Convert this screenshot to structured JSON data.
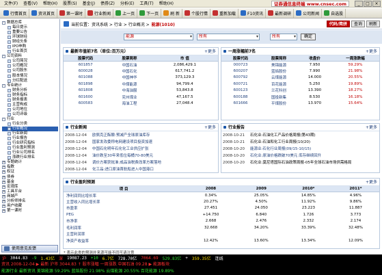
{
  "menu": [
    "文件(F)",
    "查看(V)",
    "帮助(H)",
    "股票(S)",
    "基金(J)",
    "债券(Z)",
    "分析(E)",
    "工具(T)",
    "帮助(H)"
  ],
  "brand": "证券通信息终端 www.cnsec.com",
  "window_buttons": [
    "_",
    "□",
    "×"
  ],
  "toolbar": [
    "行情首页",
    "资讯首页",
    "第一课时",
    "行业新闻",
    "上一页",
    "下一页",
    "刷 新",
    "个股行情",
    "重新加载",
    "F10资讯",
    "最新调研",
    "公司新闻",
    "自选股"
  ],
  "tree": [
    {
      "label": "数据总库",
      "level": 0,
      "box": "-"
    },
    {
      "label": "每日提示",
      "level": 1
    },
    {
      "label": "重要公告",
      "level": 1
    },
    {
      "label": "环球财经",
      "level": 1
    },
    {
      "label": "财经头条",
      "level": 1
    },
    {
      "label": "IPO申购",
      "level": 1
    },
    {
      "label": "行业首页",
      "level": 1
    },
    {
      "label": "公司资料",
      "level": 0,
      "box": "-"
    },
    {
      "label": "公司简况",
      "level": 1
    },
    {
      "label": "公司概况",
      "level": 1
    },
    {
      "label": "公司股东",
      "level": 1
    },
    {
      "label": "股本情况",
      "level": 1
    },
    {
      "label": "分红配送",
      "level": 1
    },
    {
      "label": "专业统计",
      "level": 0,
      "box": "-"
    },
    {
      "label": "财务分析",
      "level": 1
    },
    {
      "label": "财务指标",
      "level": 1
    },
    {
      "label": "财务报表",
      "level": 1
    },
    {
      "label": "主营构成",
      "level": 1
    },
    {
      "label": "公司地位",
      "level": 1
    },
    {
      "label": "公司评级",
      "level": 1
    },
    {
      "label": "行业",
      "level": 0,
      "box": "-"
    },
    {
      "label": "行业分类",
      "level": 1
    },
    {
      "label": "行业概况",
      "level": 1,
      "selected": true
    },
    {
      "label": "行业新闻",
      "level": 1
    },
    {
      "label": "行业报告",
      "level": 1
    },
    {
      "label": "行业研究指标",
      "level": 1
    },
    {
      "label": "行业盈利预测",
      "level": 1
    },
    {
      "label": "行业公司排名",
      "level": 1
    },
    {
      "label": "涨跌行业排名",
      "level": 1
    },
    {
      "label": "专题统计",
      "level": 0,
      "box": "+"
    },
    {
      "label": "指数",
      "level": 0,
      "box": "+"
    },
    {
      "label": "权证",
      "level": 0,
      "box": "+"
    },
    {
      "label": "债券",
      "level": 0,
      "box": "+"
    },
    {
      "label": "基金",
      "level": 0,
      "box": "+"
    },
    {
      "label": "宏观库",
      "level": 0,
      "box": "+"
    },
    {
      "label": "工具平台",
      "level": 0,
      "box": "+"
    },
    {
      "label": "商城产",
      "level": 0,
      "box": "+"
    },
    {
      "label": "分析师排名",
      "level": 0,
      "box": "+"
    },
    {
      "label": "用户收藏",
      "level": 0,
      "box": "+"
    },
    {
      "label": "第一课时",
      "level": 0,
      "box": "+"
    }
  ],
  "feedback_label": "使用意见反馈",
  "breadcrumb": {
    "prefix": "当前位置：",
    "path": "资讯系统 > 行业 > 行业概况 >",
    "highlight": "能源(1010)"
  },
  "breadcrumb_buttons": [
    "代码/简拼",
    "查询",
    "刷新"
  ],
  "filters": {
    "industry": "能源",
    "scope": "所有",
    "period": "所有",
    "ok": "确定"
  },
  "market_cap": {
    "title": "最新市值前7名（单位:百万元）",
    "more": "更多",
    "headers": [
      "股票代码",
      "股票简称",
      "市 值"
    ],
    "rows": [
      [
        "601857",
        "中国石油",
        "2,086,429.1"
      ],
      [
        "600028",
        "中国石化",
        "617,741.2"
      ],
      [
        "601088",
        "中国神华",
        "373,129.3"
      ],
      [
        "601898",
        "中煤能源",
        "94,799.4"
      ],
      [
        "601808",
        "中海油服",
        "53,843.8"
      ],
      [
        "601600",
        "兖州煤业",
        "47,167.5"
      ],
      [
        "600583",
        "海油工程",
        "27,048.4"
      ]
    ]
  },
  "weekly_rise": {
    "title": "一周涨幅前7名",
    "more": "更多",
    "headers": [
      "股票代码",
      "股票简称",
      "收盘价",
      "一周涨跌幅"
    ],
    "rows": [
      [
        "000723",
        "美锦能源",
        "7.950",
        "59.29%"
      ],
      [
        "600207",
        "蓝焰股份",
        "7.990",
        "21.98%"
      ],
      [
        "600792",
        "云煤能源",
        "14.000",
        "20.55%"
      ],
      [
        "600721",
        "百花能源",
        "5.250",
        "19.89%"
      ],
      [
        "600123",
        "兰花科创",
        "13.390",
        "18.27%"
      ],
      [
        "600188",
        "国投新集",
        "8.530",
        "16.18%"
      ],
      [
        "601666",
        "平煤股份",
        "13.970",
        "15.64%"
      ]
    ]
  },
  "industry_news": {
    "title": "行业新闻",
    "more": "更多",
    "items": [
      [
        "2008-12-04",
        "欧佩克正酝酿:预减产全球原油库存"
      ],
      [
        "2008-12-04",
        "国家发改委称电网建设项目投资加速"
      ],
      [
        "2008-12-04",
        "中国石化明年石化化工业供应扩张"
      ],
      [
        "2008-12-04",
        "油价跌至30年来低位每桶70-80美元"
      ],
      [
        "2008-12-04",
        "调价方案获批准:成品油税费改革方案落地"
      ],
      [
        "2008-12-04",
        "化工品:进口原油首航船进入中国港口"
      ]
    ]
  },
  "industry_reports": {
    "title": "行业报告",
    "more": "更多",
    "items": [
      [
        "2008-10-21",
        "石化业:石油化工产品价格周报(第43期)",
        "dark"
      ],
      [
        "2008-10-21",
        "石化业:石油和化工行业周报(10/20)",
        "dark"
      ],
      [
        "2008-10-20",
        "能源业:石化行业周报(09/15-10/15)",
        "link"
      ],
      [
        "2008-10-20",
        "石化业:原油价格跌破70美元 库存继续回升",
        "link"
      ],
      [
        "2008-10-20",
        "石化业:莫尼塔国际石油政策周报-05年全球石油市场供需格局",
        "dark"
      ]
    ]
  },
  "profit_forecast": {
    "title": "行业盈利预测",
    "more": "更多",
    "headers": [
      "项 目",
      "2008",
      "2009",
      "2010*",
      "2011*"
    ],
    "rows": [
      [
        "净利润同比增长率",
        "0.34%",
        "25.05%",
        "14.85%",
        "4.96%"
      ],
      [
        "主营收入同比增长率",
        "20.27%",
        "4.50%",
        "11.92%",
        "9.86%"
      ],
      [
        "市盈率",
        "27.451",
        "24.050",
        "23.223",
        "11.887"
      ],
      [
        "PEG",
        "+14.750",
        "6.840",
        "1.726",
        "3.773"
      ],
      [
        "市净率",
        "2.668",
        "2.476",
        "2.332",
        "2.174"
      ],
      [
        "毛利润率",
        "32.668",
        "34.20%",
        "33.39%",
        "32.48%"
      ],
      [
        "主营利润率",
        "",
        "",
        "",
        ""
      ],
      [
        "净资产收益率",
        "12.42%",
        "13.60%",
        "13.34%",
        "12.09%"
      ]
    ]
  },
  "footnote": "* 表示此类的预测并来源可能不同可请注意",
  "statusbar": [
    "沪",
    "3044.83",
    "-9",
    "1.43亿",
    "深",
    "19087.23",
    "+10",
    "6.7亿",
    "728.70亿",
    "7064.69",
    "529.83亿",
    "+",
    "359.35亿",
    "连线"
  ],
  "ticker_line1": "资讯 2008-12-04 ▶ 最新 沪市 3044.83 ↑ 股市涨幅 一周涨跌 中国石油 09.28 ▶ 能源板块",
  "ticker_line2": "能源行业 最新资讯 美锦能源 59.29% 蓝焰股份 21.98% 云煤能源 20.55% 百花能源 19.89%"
}
